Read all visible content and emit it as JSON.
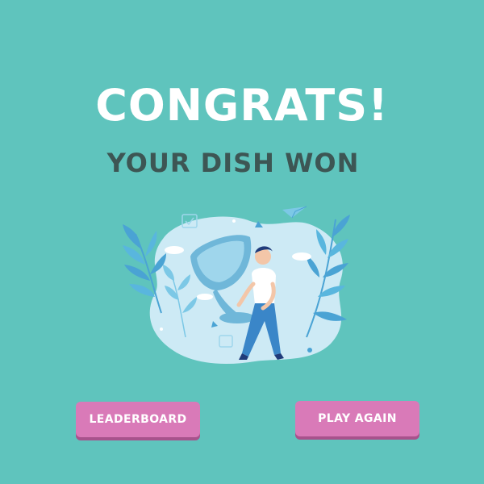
{
  "screen": {
    "headline": "CONGRATS!",
    "subheadline": "YOUR DISH WON"
  },
  "buttons": {
    "leaderboard_label": "LEADERBOARD",
    "play_again_label": "PLAY AGAIN"
  },
  "illustration": {
    "icon": "trophy-winner-icon"
  },
  "colors": {
    "background": "#5fc4bd",
    "headline": "#ffffff",
    "subheadline": "#3d5654",
    "button": "#d97ab8",
    "button_shadow": "#a8528c",
    "blob": "#cdeaf5",
    "leaf": "#4aa3d4"
  }
}
